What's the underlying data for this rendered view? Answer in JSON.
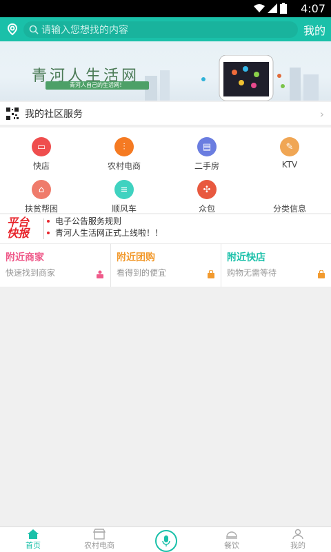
{
  "status": {
    "time": "4:07"
  },
  "topbar": {
    "search_placeholder": "请输入您想找的内容",
    "mine": "我的"
  },
  "banner": {
    "title": "青河人生活网",
    "tagline": "青河人自己的生活网！"
  },
  "community": {
    "label": "我的社区服务"
  },
  "services": [
    {
      "label": "快店",
      "color": "#ef4e4e",
      "icon": "shop-icon"
    },
    {
      "label": "农村电商",
      "color": "#f57a22",
      "icon": "cutlery-icon"
    },
    {
      "label": "二手房",
      "color": "#6a7de0",
      "icon": "building-icon"
    },
    {
      "label": "KTV",
      "color": "#f0a654",
      "icon": "mic-icon"
    },
    {
      "label": "扶贫帮困",
      "color": "#ef7b6b",
      "icon": "tent-icon"
    },
    {
      "label": "顺风车",
      "color": "#3fd2c0",
      "icon": "list-icon"
    },
    {
      "label": "众包",
      "color": "#e8593f",
      "icon": "puzzle-icon"
    },
    {
      "label": "分类信息",
      "color": "#ffffff",
      "icon": "none"
    }
  ],
  "news": {
    "logo_line1": "平台",
    "logo_line2": "快报",
    "items": [
      "电子公告服务规则",
      "青河人生活网正式上线啦！！"
    ]
  },
  "nearby": [
    {
      "title": "附近商家",
      "subtitle": "快速找到商家",
      "color": "#ef5a8a"
    },
    {
      "title": "附近团购",
      "subtitle": "看得到的便宜",
      "color": "#f29a2e"
    },
    {
      "title": "附近快店",
      "subtitle": "购物无需等待",
      "color": "#1ac0a9"
    }
  ],
  "tabs": [
    "首页",
    "农村电商",
    "餐饮",
    "我的"
  ]
}
